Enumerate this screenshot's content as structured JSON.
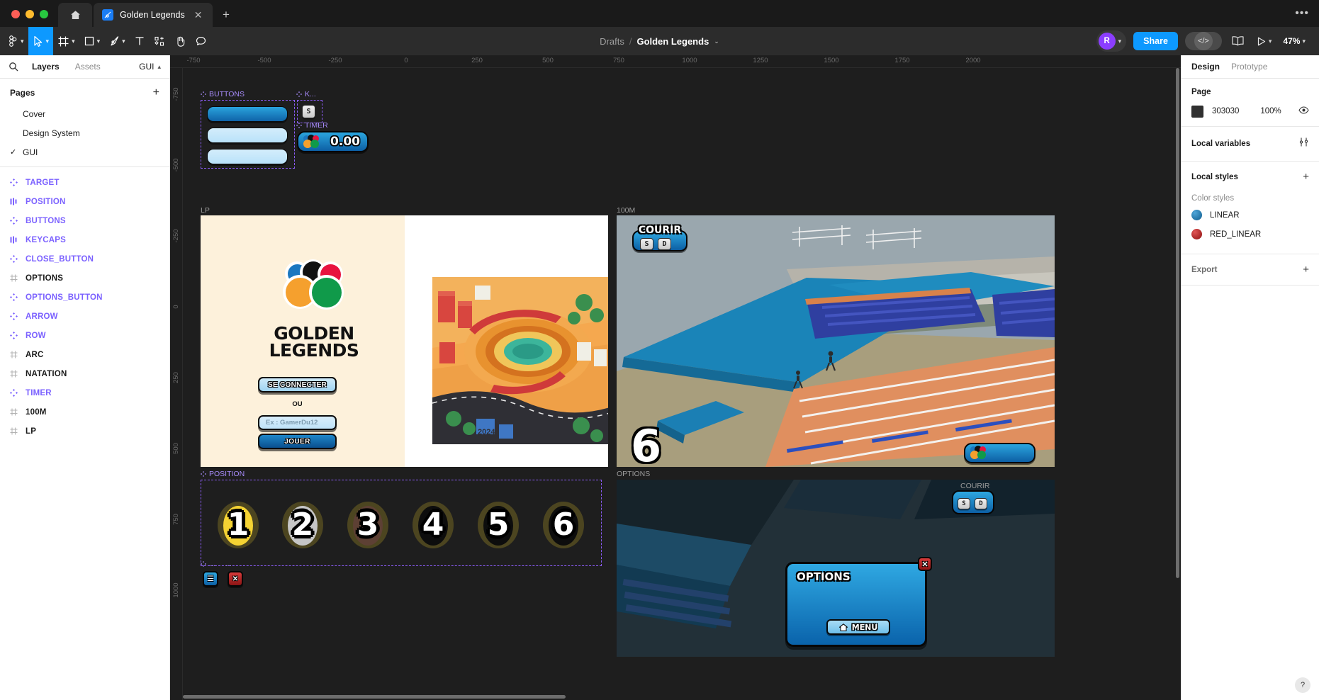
{
  "titlebar": {
    "home_icon": "home-icon",
    "tab": {
      "label": "Golden Legends",
      "close": "✕",
      "icon": "figma-file-icon"
    },
    "new_tab": "+",
    "overflow": "•••"
  },
  "toolbar": {
    "tools": [
      {
        "name": "figma-menu",
        "glyph": "F",
        "caret": true,
        "active": false
      },
      {
        "name": "move-tool",
        "glyph": "▷",
        "caret": true,
        "active": true
      },
      {
        "name": "frame-tool",
        "glyph": "#",
        "caret": true,
        "active": false
      },
      {
        "name": "shape-tool",
        "glyph": "□",
        "caret": true,
        "active": false
      },
      {
        "name": "pen-tool",
        "glyph": "✒",
        "caret": true,
        "active": false
      },
      {
        "name": "text-tool",
        "glyph": "T",
        "caret": false,
        "active": false
      },
      {
        "name": "actions-tool",
        "glyph": "✦",
        "caret": false,
        "active": false
      },
      {
        "name": "hand-tool",
        "glyph": "✋",
        "caret": false,
        "active": false
      },
      {
        "name": "comment-tool",
        "glyph": "○",
        "caret": false,
        "active": false
      }
    ],
    "breadcrumb": {
      "project": "Drafts",
      "separator": "/",
      "file": "Golden Legends",
      "caret": "⌄"
    },
    "avatar": {
      "initial": "R",
      "color": "#8b3dff"
    },
    "share_label": "Share",
    "dev_mode_label": "</>",
    "library_icon": "book-icon",
    "present_icon": "play-icon",
    "zoom_level": "47%"
  },
  "left_panel": {
    "tabs": [
      {
        "label": "Layers",
        "selected": true
      },
      {
        "label": "Assets",
        "selected": false
      }
    ],
    "page_selector": "GUI",
    "pages_header": "Pages",
    "pages": [
      {
        "name": "Cover",
        "current": false
      },
      {
        "name": "Design System",
        "current": false
      },
      {
        "name": "GUI",
        "current": true
      }
    ],
    "layers": [
      {
        "name": "TARGET",
        "type": "component"
      },
      {
        "name": "POSITION",
        "type": "component-set"
      },
      {
        "name": "BUTTONS",
        "type": "component"
      },
      {
        "name": "KEYCAPS",
        "type": "component-set"
      },
      {
        "name": "CLOSE_BUTTON",
        "type": "component"
      },
      {
        "name": "OPTIONS",
        "type": "frame"
      },
      {
        "name": "OPTIONS_BUTTON",
        "type": "component"
      },
      {
        "name": "ARROW",
        "type": "component"
      },
      {
        "name": "ROW",
        "type": "component"
      },
      {
        "name": "ARC",
        "type": "frame"
      },
      {
        "name": "NATATION",
        "type": "frame"
      },
      {
        "name": "TIMER",
        "type": "component"
      },
      {
        "name": "100M",
        "type": "frame"
      },
      {
        "name": "LP",
        "type": "frame"
      }
    ]
  },
  "right_panel": {
    "tabs": [
      {
        "label": "Design",
        "selected": true
      },
      {
        "label": "Prototype",
        "selected": false
      }
    ],
    "page_section": {
      "title": "Page",
      "color_hex": "303030",
      "color_value": "#303030",
      "opacity": "100%",
      "visibility_icon": "eye-icon"
    },
    "local_variables": {
      "title": "Local variables",
      "icon": "sliders-icon"
    },
    "local_styles": {
      "title": "Local styles",
      "add": "+"
    },
    "color_styles_label": "Color styles",
    "color_styles": [
      {
        "name": "LINEAR",
        "color": "#1a74a8"
      },
      {
        "name": "RED_LINEAR",
        "color": "#b32222"
      }
    ],
    "export": {
      "title": "Export",
      "add": "+"
    }
  },
  "canvas": {
    "ruler_h": [
      "-750",
      "-500",
      "-250",
      "0",
      "250",
      "500",
      "750",
      "1000",
      "1250",
      "1500",
      "1750",
      "2000"
    ],
    "ruler_v": [
      "-750",
      "-500",
      "-250",
      "0",
      "250",
      "500",
      "750",
      "1000"
    ],
    "frames": {
      "buttons": {
        "label": "BUTTONS"
      },
      "keycaps": {
        "label": "K...",
        "key": "S"
      },
      "timer": {
        "label": "TIMER",
        "value": "0.00"
      },
      "lp": {
        "label": "LP",
        "title_line1": "GOLDEN",
        "title_line2": "LEGENDS",
        "login_button": "SE CONNECTER",
        "divider": "OU",
        "input_placeholder": "Ex : GamerDu12",
        "play_button": "JOUER"
      },
      "position": {
        "label": "POSITION",
        "medals": [
          {
            "num": "1",
            "disc": "#f5d333",
            "ring": "#4c4520"
          },
          {
            "num": "2",
            "disc": "#c6c6c6",
            "ring": "#4c4520"
          },
          {
            "num": "3",
            "disc": "#5d4034",
            "ring": "#4c4520"
          },
          {
            "num": "4",
            "disc": "#0d0d0d",
            "ring": "#4c4520"
          },
          {
            "num": "5",
            "disc": "#0d0d0d",
            "ring": "#4c4520"
          },
          {
            "num": "6",
            "disc": "#0d0d0d",
            "ring": "#4c4520"
          }
        ]
      },
      "small_buttons": {
        "menu_glyph": "☰",
        "close_glyph": "✕"
      },
      "m100": {
        "label": "100M",
        "courir": "COURIR",
        "keys": [
          "S",
          "D"
        ],
        "lane_number": "6"
      },
      "options": {
        "label": "OPTIONS",
        "dialog_title": "OPTIONS",
        "close": "✕",
        "menu_button": "MENU",
        "home_icon": "home-icon"
      },
      "courir_partial": {
        "label": "COURIR",
        "keys": [
          "S",
          "D"
        ]
      }
    }
  },
  "help_button": "?"
}
